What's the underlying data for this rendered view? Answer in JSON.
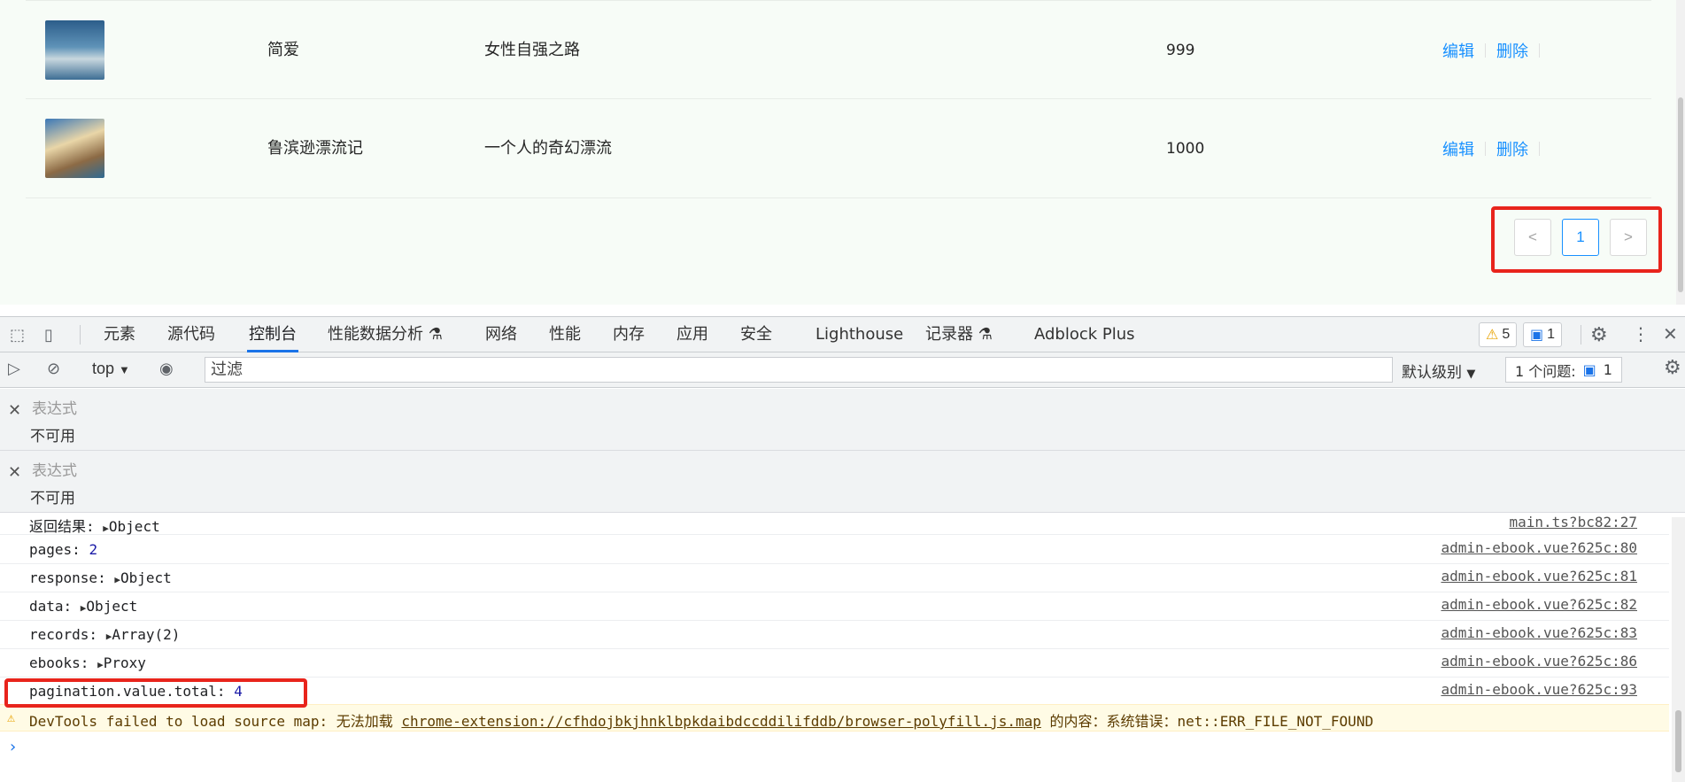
{
  "books": [
    {
      "name": "简爱",
      "description": "女性自强之路",
      "count": "999",
      "edit": "编辑",
      "delete": "删除"
    },
    {
      "name": "鲁滨逊漂流记",
      "description": "一个人的奇幻漂流",
      "count": "1000",
      "edit": "编辑",
      "delete": "删除"
    }
  ],
  "pagination": {
    "prev": "<",
    "current": "1",
    "next": ">"
  },
  "devtools": {
    "tabs": [
      "元素",
      "源代码",
      "控制台",
      "性能数据分析 ⚗",
      "网络",
      "性能",
      "内存",
      "应用",
      "安全",
      "Lighthouse",
      "记录器 ⚗",
      "Adblock Plus"
    ],
    "active_tab": "控制台",
    "warning_count": "5",
    "message_count": "1",
    "context": "top",
    "filter_placeholder": "过滤",
    "level": "默认级别",
    "issues_label": "1 个问题:",
    "issues_count": "1"
  },
  "expressions": [
    {
      "label": "表达式",
      "value": "不可用"
    },
    {
      "label": "表达式",
      "value": "不可用"
    }
  ],
  "console_logs": [
    {
      "label": "返回结果: ",
      "value": "Object",
      "expandable": true,
      "source": "main.ts?bc82:27"
    },
    {
      "label": "pages: ",
      "value": "2",
      "expandable": false,
      "source": "admin-ebook.vue?625c:80"
    },
    {
      "label": "response: ",
      "value": "Object",
      "expandable": true,
      "source": "admin-ebook.vue?625c:81"
    },
    {
      "label": "data: ",
      "value": "Object",
      "expandable": true,
      "source": "admin-ebook.vue?625c:82"
    },
    {
      "label": "records: ",
      "value": "Array(2)",
      "expandable": true,
      "source": "admin-ebook.vue?625c:83"
    },
    {
      "label": "ebooks: ",
      "value": "Proxy",
      "expandable": true,
      "source": "admin-ebook.vue?625c:86"
    },
    {
      "label": "pagination.value.total: ",
      "value": "4",
      "expandable": false,
      "source": "admin-ebook.vue?625c:93"
    }
  ],
  "warning": {
    "prefix": "DevTools failed to load source map: 无法加载 ",
    "link": "chrome-extension://cfhdojbkjhnklbpkdaibdccddilifddb/browser-polyfill.js.map",
    "suffix": " 的内容：系统错误：net::ERR_FILE_NOT_FOUND"
  },
  "colors": {
    "link": "#1890ff",
    "highlight": "#e8241c",
    "number": "#1a1aa6"
  }
}
